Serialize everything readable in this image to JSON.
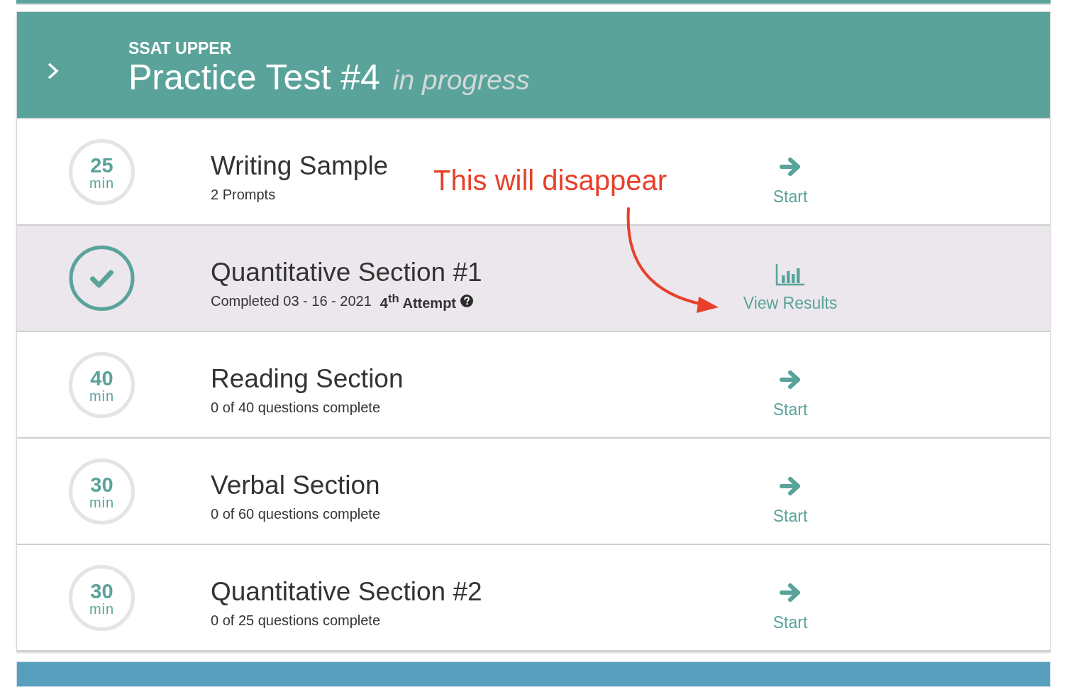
{
  "test": {
    "category": "SSAT UPPER",
    "title": "Practice Test #4",
    "status": "in progress"
  },
  "sections": [
    {
      "kind": "timed",
      "minutes": "25",
      "unit": "min",
      "title": "Writing Sample",
      "detail": "2 Prompts",
      "action": {
        "kind": "start",
        "label": "Start"
      }
    },
    {
      "kind": "completed",
      "title": "Quantitative Section #1",
      "detail": "Completed 03 - 16 - 2021",
      "attempt": "4$^{th}$ Attempt",
      "action": {
        "kind": "results",
        "label": "View Results"
      }
    },
    {
      "kind": "timed",
      "minutes": "40",
      "unit": "min",
      "title": "Reading Section",
      "detail": "0 of 40 questions complete",
      "action": {
        "kind": "start",
        "label": "Start"
      }
    },
    {
      "kind": "timed",
      "minutes": "30",
      "unit": "min",
      "title": "Verbal Section",
      "detail": "0 of 60 questions complete",
      "action": {
        "kind": "start",
        "label": "Start"
      }
    },
    {
      "kind": "timed",
      "minutes": "30",
      "unit": "min",
      "title": "Quantitative Section #2",
      "detail": "0 of 25 questions complete",
      "action": {
        "kind": "start",
        "label": "Start"
      }
    }
  ],
  "annotation": {
    "text": "This will disappear"
  }
}
